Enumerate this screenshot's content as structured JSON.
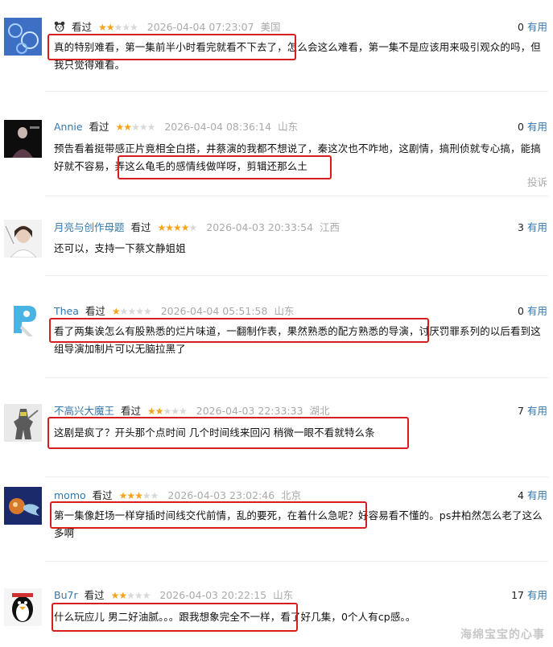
{
  "comments": [
    {
      "user": "",
      "watched": "看过",
      "rating": 2,
      "time": "2026-04-04 07:23:07",
      "location": "美国",
      "useful_count": "0",
      "useful_label": "有用",
      "text": "真的特别难看，第一集前半小时看完就看不下去了，怎么会这么难看，第一集不是应该用来吸引观众的吗，但我只觉得难看。"
    },
    {
      "user": "Annie",
      "watched": "看过",
      "rating": 2,
      "time": "2026-04-04 08:36:14",
      "location": "山东",
      "useful_count": "0",
      "useful_label": "有用",
      "text": "预告看着挺带感正片竟相全白搭，井蔡演的我都不想说了，秦这次也不咋地，这剧情，搞刑侦就专心搞，能搞好就不容易，弄这么龟毛的感情线做咩呀，剪辑还那么土",
      "report": "投诉"
    },
    {
      "user": "月亮与创作母题",
      "watched": "看过",
      "rating": 4,
      "time": "2026-04-03 20:33:54",
      "location": "江西",
      "useful_count": "3",
      "useful_label": "有用",
      "text": "还可以，支持一下蔡文静姐姐"
    },
    {
      "user": "Thea",
      "watched": "看过",
      "rating": 1,
      "time": "2026-04-04 05:51:58",
      "location": "山东",
      "useful_count": "0",
      "useful_label": "有用",
      "text": "看了两集诶怎么有股熟悉的烂片味道，一翻制作表，果然熟悉的配方熟悉的导演，讨厌罚罪系列的以后看到这组导演加制片可以无脑拉黑了"
    },
    {
      "user": "不高兴大魔王",
      "watched": "看过",
      "rating": 2,
      "time": "2026-04-03 22:33:33",
      "location": "湖北",
      "useful_count": "7",
      "useful_label": "有用",
      "text": "这剧是疯了？开头那个点时间 几个时间线来回闪 稍微一眼不看就特么条"
    },
    {
      "user": "momo",
      "watched": "看过",
      "rating": 3,
      "time": "2026-04-03 23:02:46",
      "location": "北京",
      "useful_count": "4",
      "useful_label": "有用",
      "text": "第一集像赶场一样穿插时间线交代前情，乱的要死，在着什么急呢？好容易看不懂的。ps井柏然怎么老了这么多啊"
    },
    {
      "user": "Bu7r",
      "watched": "看过",
      "rating": 2,
      "time": "2026-04-03 20:22:15",
      "location": "山东",
      "useful_count": "17",
      "useful_label": "有用",
      "text": "什么玩应儿 男二好油腻。。。跟我想象完全不一样，看了好几集，0个人有cp感。。"
    }
  ],
  "watermark": "海绵宝宝的心事",
  "colors": {
    "username": "#3377aa",
    "star": "#f7a31c",
    "highlight": "#d61e1e",
    "muted": "#aaaaaa"
  }
}
